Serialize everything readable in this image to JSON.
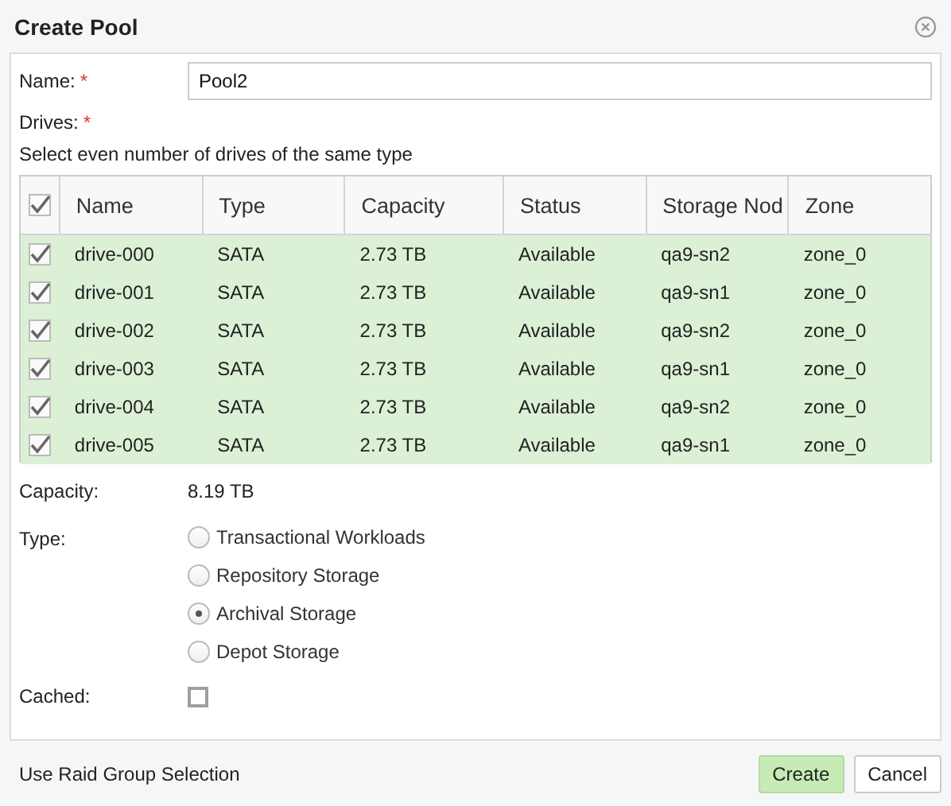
{
  "window": {
    "title": "Create Pool"
  },
  "name_field": {
    "label": "Name:",
    "required_mark": "*",
    "value": "Pool2"
  },
  "drives": {
    "label": "Drives:",
    "required_mark": "*",
    "hint": "Select even number of drives of the same type"
  },
  "table": {
    "all_checked": true,
    "columns": [
      "Name",
      "Type",
      "Capacity",
      "Status",
      "Storage Nod",
      "Zone"
    ],
    "rows": [
      {
        "selected": true,
        "checked": true,
        "cells": [
          "drive-000",
          "SATA",
          "2.73 TB",
          "Available",
          "qa9-sn2",
          "zone_0"
        ]
      },
      {
        "selected": true,
        "checked": true,
        "cells": [
          "drive-001",
          "SATA",
          "2.73 TB",
          "Available",
          "qa9-sn1",
          "zone_0"
        ]
      },
      {
        "selected": true,
        "checked": true,
        "cells": [
          "drive-002",
          "SATA",
          "2.73 TB",
          "Available",
          "qa9-sn2",
          "zone_0"
        ]
      },
      {
        "selected": true,
        "checked": true,
        "cells": [
          "drive-003",
          "SATA",
          "2.73 TB",
          "Available",
          "qa9-sn1",
          "zone_0"
        ]
      },
      {
        "selected": true,
        "checked": true,
        "cells": [
          "drive-004",
          "SATA",
          "2.73 TB",
          "Available",
          "qa9-sn2",
          "zone_0"
        ]
      },
      {
        "selected": true,
        "checked": true,
        "cells": [
          "drive-005",
          "SATA",
          "2.73 TB",
          "Available",
          "qa9-sn1",
          "zone_0"
        ]
      }
    ]
  },
  "capacity": {
    "label": "Capacity:",
    "value": "8.19 TB"
  },
  "type": {
    "label": "Type:",
    "options": [
      {
        "label": "Transactional Workloads",
        "selected": false
      },
      {
        "label": "Repository Storage",
        "selected": false
      },
      {
        "label": "Archival Storage",
        "selected": true
      },
      {
        "label": "Depot Storage",
        "selected": false
      }
    ]
  },
  "cached": {
    "label": "Cached:",
    "checked": false
  },
  "footer": {
    "link": "Use Raid Group Selection",
    "buttons": [
      {
        "label": "Create",
        "kind": "primary"
      },
      {
        "label": "Cancel",
        "kind": "secondary"
      }
    ]
  }
}
